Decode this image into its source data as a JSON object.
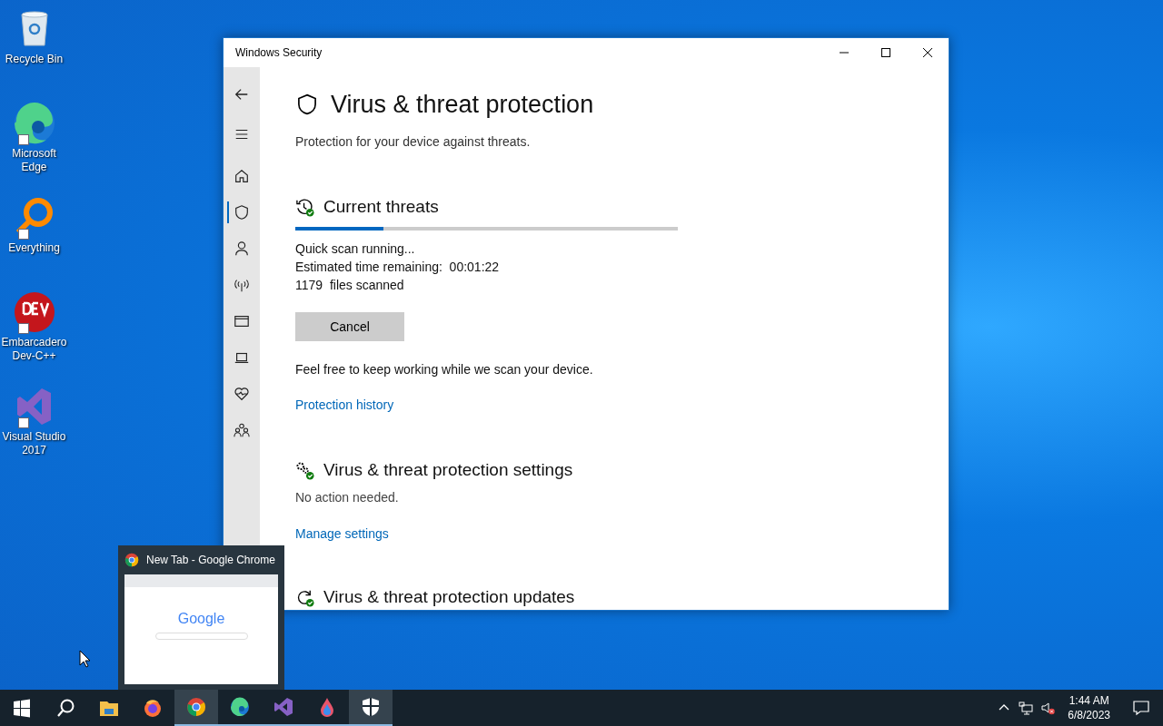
{
  "desktop_icons": [
    {
      "kind": "recycle",
      "label": "Recycle Bin"
    },
    {
      "kind": "edge",
      "label": "Microsoft Edge",
      "shortcut": true
    },
    {
      "kind": "everything",
      "label": "Everything",
      "shortcut": true
    },
    {
      "kind": "devcpp",
      "label": "Embarcadero Dev-C++",
      "shortcut": true
    },
    {
      "kind": "vs",
      "label": "Visual Studio 2017",
      "shortcut": true
    }
  ],
  "window": {
    "title": "Windows Security",
    "nav": [
      {
        "kind": "back",
        "selected": false
      },
      {
        "kind": "menu",
        "selected": false
      },
      {
        "kind": "home",
        "selected": false
      },
      {
        "kind": "shield",
        "selected": true
      },
      {
        "kind": "person",
        "selected": false
      },
      {
        "kind": "antenna",
        "selected": false
      },
      {
        "kind": "browser",
        "selected": false
      },
      {
        "kind": "laptop",
        "selected": false
      },
      {
        "kind": "heart",
        "selected": false
      },
      {
        "kind": "family",
        "selected": false
      }
    ],
    "heading": "Virus & threat protection",
    "subtitle": "Protection for your device against threats.",
    "current_threats": {
      "title": "Current threats",
      "level": 0.23,
      "lines": [
        "Quick scan running...",
        "Estimated time remaining:  00:01:22",
        "1179  files scanned"
      ],
      "button": "Cancel",
      "note": "Feel free to keep working while we scan your device.",
      "link": "Protection history"
    },
    "settings": {
      "title": "Virus & threat protection settings",
      "status": "No action needed.",
      "link": "Manage settings"
    },
    "updates": {
      "title": "Virus & threat protection updates"
    }
  },
  "preview": {
    "title": "New Tab - Google Chrome",
    "thumbnail_logo": "Google"
  },
  "taskbar": {
    "apps": [
      {
        "kind": "start",
        "running": false,
        "highlighted": false
      },
      {
        "kind": "search",
        "running": false,
        "highlighted": false
      },
      {
        "kind": "folder",
        "running": false,
        "highlighted": false
      },
      {
        "kind": "firefox",
        "running": false,
        "highlighted": false
      },
      {
        "kind": "chrome",
        "running": true,
        "highlighted": true
      },
      {
        "kind": "edge",
        "running": true,
        "highlighted": false
      },
      {
        "kind": "vs",
        "running": true,
        "highlighted": false
      },
      {
        "kind": "drop",
        "running": true,
        "highlighted": false
      },
      {
        "kind": "shield",
        "running": true,
        "highlighted": true
      }
    ],
    "time": "1:44 AM",
    "date": "6/8/2023"
  }
}
